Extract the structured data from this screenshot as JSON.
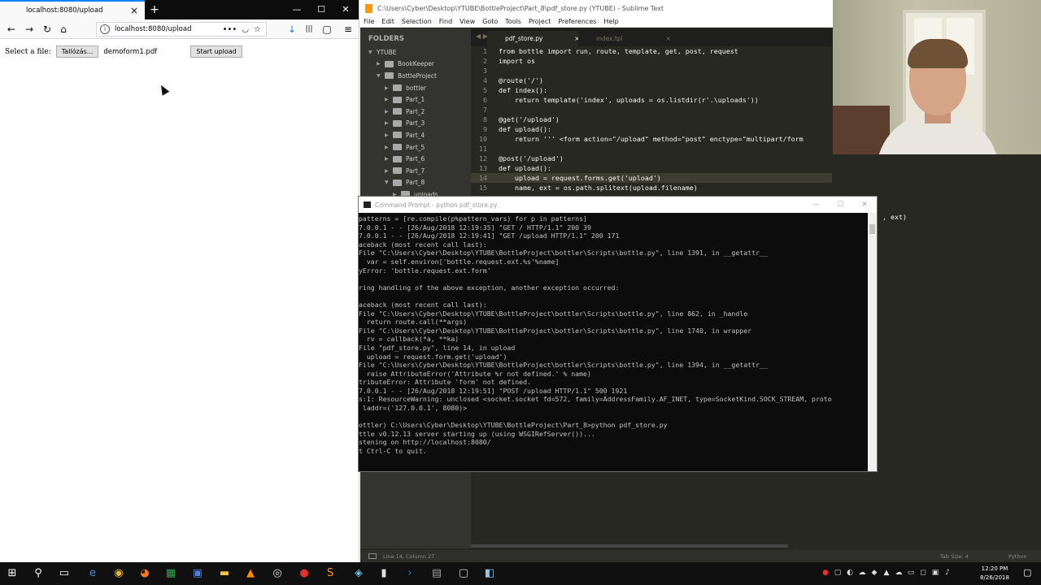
{
  "firefox": {
    "tab_title": "localhost:8080/upload",
    "new_tab": "+",
    "url": "localhost:8080/upload",
    "icons": {
      "back": "←",
      "forward": "→",
      "reload": "↻",
      "home": "⌂",
      "info": "i",
      "more": "•••",
      "pocket": "◡",
      "bookmark": "☆",
      "download": "↓",
      "library": "|||",
      "sidebar": "▢",
      "menu": "≡"
    },
    "window": {
      "minimize": "—",
      "maximize": "☐",
      "close": "✕"
    }
  },
  "page": {
    "file_label": "Select a file:",
    "browse_button": "Tallózás...",
    "file_name": "demoform1.pdf",
    "upload_button": "Start upload"
  },
  "sublime": {
    "title": "C:\\Users\\Cyber\\Desktop\\YTUBE\\BottleProject\\Part_8\\pdf_store.py (YTUBE) - Sublime Text",
    "menu": [
      "File",
      "Edit",
      "Selection",
      "Find",
      "View",
      "Goto",
      "Tools",
      "Project",
      "Preferences",
      "Help"
    ],
    "sidebar_header": "FOLDERS",
    "tree": [
      {
        "label": "YTUBE",
        "arrow": "▼",
        "folder": false,
        "indent": 0
      },
      {
        "label": "BookKeeper",
        "arrow": "▶",
        "folder": true,
        "indent": 1
      },
      {
        "label": "BottleProject",
        "arrow": "▼",
        "folder": true,
        "indent": 1
      },
      {
        "label": "bottler",
        "arrow": "▶",
        "folder": true,
        "indent": 2
      },
      {
        "label": "Part_1",
        "arrow": "▶",
        "folder": true,
        "indent": 2
      },
      {
        "label": "Part_2",
        "arrow": "▶",
        "folder": true,
        "indent": 2
      },
      {
        "label": "Part_3",
        "arrow": "▶",
        "folder": true,
        "indent": 2
      },
      {
        "label": "Part_4",
        "arrow": "▶",
        "folder": true,
        "indent": 2
      },
      {
        "label": "Part_5",
        "arrow": "▶",
        "folder": true,
        "indent": 2
      },
      {
        "label": "Part_6",
        "arrow": "▶",
        "folder": true,
        "indent": 2
      },
      {
        "label": "Part_7",
        "arrow": "▶",
        "folder": true,
        "indent": 2
      },
      {
        "label": "Part_8",
        "arrow": "▼",
        "folder": true,
        "indent": 2
      },
      {
        "label": "uploads",
        "arrow": "▶",
        "folder": true,
        "indent": 3
      }
    ],
    "tabs": [
      {
        "label": "pdf_store.py",
        "close": "×"
      },
      {
        "label": "index.tpl",
        "close": "×"
      }
    ],
    "tab_nav": "◀ ▶",
    "code": [
      {
        "n": "1",
        "t": "from bottle import run, route, template, get, post, request",
        "hl": false
      },
      {
        "n": "2",
        "t": "import os",
        "hl": false
      },
      {
        "n": "3",
        "t": "",
        "hl": false
      },
      {
        "n": "4",
        "t": "@route('/')",
        "hl": false
      },
      {
        "n": "5",
        "t": "def index():",
        "hl": false
      },
      {
        "n": "6",
        "t": "    return template('index', uploads = os.listdir(r'.\\uploads'))",
        "hl": false
      },
      {
        "n": "7",
        "t": "",
        "hl": false
      },
      {
        "n": "8",
        "t": "@get('/upload')",
        "hl": false
      },
      {
        "n": "9",
        "t": "def upload():",
        "hl": false
      },
      {
        "n": "10",
        "t": "    return ''' <form action=\"/upload\" method=\"post\" enctype=\"multipart/form",
        "hl": false
      },
      {
        "n": "11",
        "t": "",
        "hl": false
      },
      {
        "n": "12",
        "t": "@post('/upload')",
        "hl": false
      },
      {
        "n": "13",
        "t": "def upload():",
        "hl": false
      },
      {
        "n": "14",
        "t": "    upload = request.forms.get('upload')",
        "hl": true
      },
      {
        "n": "15",
        "t": "    name, ext = os.path.splitext(upload.filename)",
        "hl": false
      }
    ],
    "code_fragment": ", ext)",
    "status_left": "Line 14, Column 27",
    "status_tab": "Tab Size: 4",
    "status_syntax": "Python"
  },
  "cmd": {
    "title": "Command Prompt - python  pdf_store.py",
    "lines": [
      "patterns = [re.compile(p%pattern_vars) for p in patterns]",
      "7.0.0.1 - - [26/Aug/2018 12:19:35] \"GET / HTTP/1.1\" 200 39",
      "7.0.0.1 - - [26/Aug/2018 12:19:41] \"GET /upload HTTP/1.1\" 200 171",
      "aceback (most recent call last):",
      "File \"C:\\Users\\Cyber\\Desktop\\YTUBE\\BottleProject\\bottler\\Scripts\\bottle.py\", line 1391, in __getattr__",
      "  var = self.environ['bottle.request.ext.%s'%name]",
      "yError: 'bottle.request.ext.form'",
      "",
      "ring handling of the above exception, another exception occurred:",
      "",
      "aceback (most recent call last):",
      "File \"C:\\Users\\Cyber\\Desktop\\YTUBE\\BottleProject\\bottler\\Scripts\\bottle.py\", line 862, in _handle",
      "  return route.call(**args)",
      "File \"C:\\Users\\Cyber\\Desktop\\YTUBE\\BottleProject\\bottler\\Scripts\\bottle.py\", line 1740, in wrapper",
      "  rv = callback(*a, **ka)",
      "File \"pdf_store.py\", line 14, in upload",
      "  upload = request.form.get('upload')",
      "File \"C:\\Users\\Cyber\\Desktop\\YTUBE\\BottleProject\\bottler\\Scripts\\bottle.py\", line 1394, in __getattr__",
      "  raise AttributeError('Attribute %r not defined.' % name)",
      "tributeError: Attribute 'form' not defined.",
      "7.0.0.1 - - [26/Aug/2018 12:19:51] \"POST /upload HTTP/1.1\" 500 1921",
      "s:1: ResourceWarning: unclosed <socket.socket fd=572, family=AddressFamily.AF_INET, type=SocketKind.SOCK_STREAM, proto",
      " laddr=('127.0.0.1', 8080)>",
      "",
      "ottler) C:\\Users\\Cyber\\Desktop\\YTUBE\\BottleProject\\Part_8>python pdf_store.py",
      "ttle v0.12.13 server starting up (using WSGIRefServer())...",
      "stening on http://localhost:8080/",
      "t Ctrl-C to quit."
    ]
  },
  "taskbar": {
    "apps": [
      {
        "name": "start-icon",
        "glyph": "⊞",
        "color": "#ffffff"
      },
      {
        "name": "search-icon",
        "glyph": "⚲",
        "color": "#ffffff"
      },
      {
        "name": "task-view-icon",
        "glyph": "▭",
        "color": "#ffffff"
      },
      {
        "name": "edge-icon",
        "glyph": "e",
        "color": "#3c8dde"
      },
      {
        "name": "chrome-icon",
        "glyph": "◉",
        "color": "#e4b631"
      },
      {
        "name": "firefox-icon",
        "glyph": "◕",
        "color": "#f07c1c"
      },
      {
        "name": "store-icon",
        "glyph": "▦",
        "color": "#2fa84f"
      },
      {
        "name": "save-app-icon",
        "glyph": "▣",
        "color": "#4f7fd6"
      },
      {
        "name": "file-explorer-icon",
        "glyph": "▬",
        "color": "#f4c13b"
      },
      {
        "name": "vlc-icon",
        "glyph": "▲",
        "color": "#ff8800"
      },
      {
        "name": "obs-icon",
        "glyph": "◎",
        "color": "#dddddd"
      },
      {
        "name": "record-icon",
        "glyph": "●",
        "color": "#e03030"
      },
      {
        "name": "sublime-icon",
        "glyph": "S",
        "color": "#ff9800"
      },
      {
        "name": "network-app-icon",
        "glyph": "◈",
        "color": "#6fb7e0"
      },
      {
        "name": "cmd-icon",
        "glyph": "▮",
        "color": "#dddddd"
      },
      {
        "name": "powershell-icon",
        "glyph": "›",
        "color": "#3a7bd5"
      },
      {
        "name": "database-icon",
        "glyph": "▤",
        "color": "#9a9a9a"
      },
      {
        "name": "remote-desktop-icon",
        "glyph": "▢",
        "color": "#cccccc"
      },
      {
        "name": "window-icon",
        "glyph": "◧",
        "color": "#8ec5f0"
      }
    ],
    "tray": [
      "●",
      "▢",
      "◐",
      "☁",
      "◆",
      "▲",
      "☁",
      "▭",
      "◻",
      "▣",
      "♪"
    ],
    "time": "12:20 PM",
    "date": "8/26/2018",
    "notification": "▢"
  }
}
